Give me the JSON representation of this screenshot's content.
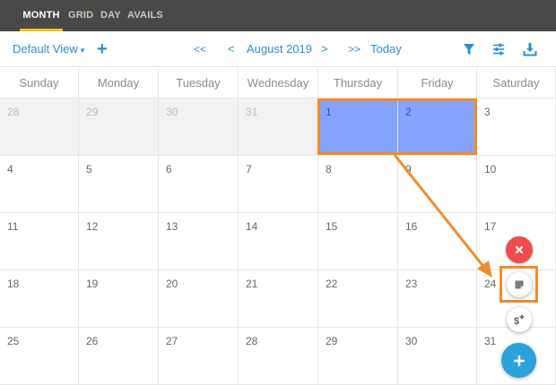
{
  "top_tabs": {
    "month": "MONTH",
    "grid": "GRID",
    "day": "DAY",
    "avails": "AVAILS",
    "active": "MONTH"
  },
  "toolbar": {
    "view_label": "Default View",
    "view_caret": "▾",
    "add_label": "+",
    "first_label": "<<",
    "prev_label": "<",
    "month_label": "August 2019",
    "next_label": ">",
    "last_label": ">>",
    "today_label": "Today",
    "icons": [
      "filter-icon",
      "sliders-icon",
      "download-icon"
    ]
  },
  "calendar": {
    "weekdays": [
      "Sunday",
      "Monday",
      "Tuesday",
      "Wednesday",
      "Thursday",
      "Friday",
      "Saturday"
    ],
    "weeks": [
      [
        {
          "day": "28",
          "outside": true
        },
        {
          "day": "29",
          "outside": true
        },
        {
          "day": "30",
          "outside": true
        },
        {
          "day": "31",
          "outside": true
        },
        {
          "day": "1",
          "selected": true
        },
        {
          "day": "2",
          "selected": true
        },
        {
          "day": "3"
        }
      ],
      [
        {
          "day": "4"
        },
        {
          "day": "5"
        },
        {
          "day": "6"
        },
        {
          "day": "7"
        },
        {
          "day": "8"
        },
        {
          "day": "9"
        },
        {
          "day": "10"
        }
      ],
      [
        {
          "day": "11"
        },
        {
          "day": "12"
        },
        {
          "day": "13"
        },
        {
          "day": "14"
        },
        {
          "day": "15"
        },
        {
          "day": "16"
        },
        {
          "day": "17"
        }
      ],
      [
        {
          "day": "18"
        },
        {
          "day": "19"
        },
        {
          "day": "20"
        },
        {
          "day": "21"
        },
        {
          "day": "22"
        },
        {
          "day": "23"
        },
        {
          "day": "24"
        }
      ],
      [
        {
          "day": "25"
        },
        {
          "day": "26"
        },
        {
          "day": "27"
        },
        {
          "day": "28"
        },
        {
          "day": "29"
        },
        {
          "day": "30"
        },
        {
          "day": "31"
        }
      ]
    ]
  },
  "fab": {
    "close_icon": "close-icon",
    "note_icon": "note-icon",
    "price_icon": "dollar-plus-icon",
    "add_icon": "plus-icon"
  },
  "colors": {
    "topbar_bg": "#4a4846",
    "active_tab_underline": "#f5c518",
    "accent": "#2a8fd0",
    "selection": "#84a3fc",
    "highlight_orange": "#f28c28",
    "close_red": "#ef4b4b",
    "add_blue": "#2ba2dc"
  }
}
